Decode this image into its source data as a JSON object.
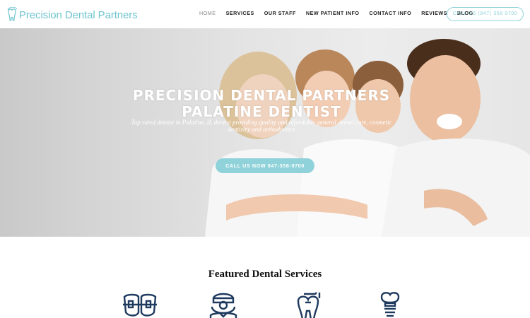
{
  "header": {
    "logo_text": "Precision Dental Partners",
    "nav": [
      {
        "label": "HOME",
        "active": true
      },
      {
        "label": "SERVICES",
        "active": false
      },
      {
        "label": "OUR STAFF",
        "active": false
      },
      {
        "label": "NEW PATIENT INFO",
        "active": false
      },
      {
        "label": "CONTACT INFO",
        "active": false
      },
      {
        "label": "REVIEWS",
        "active": false
      },
      {
        "label": "BLOG",
        "active": false
      }
    ],
    "call_button": "CALL US (847) 358 9700"
  },
  "hero": {
    "title_line1": "PRECISION DENTAL PARTNERS",
    "title_line2": "PALATINE DENTIST",
    "subtitle": "Top rated dentist in Palatine, IL dentist providing quality and affordable general dental care, cosmetic dentistry and orthodontics",
    "cta": "CALL US NOW 847-358-9700"
  },
  "featured": {
    "title": "Featured Dental Services",
    "icons": [
      "braces-icon",
      "dentist-icon",
      "tooth-filling-icon",
      "dental-implant-icon"
    ]
  },
  "colors": {
    "accent": "#8fd2d9",
    "logo": "#6fc5cf",
    "icon": "#1f3a5f"
  }
}
